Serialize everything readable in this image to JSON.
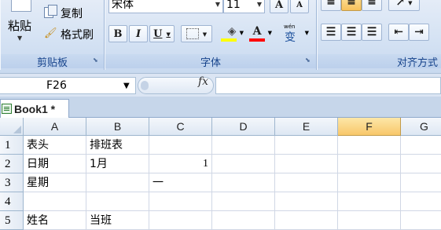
{
  "ribbon": {
    "clipboard": {
      "paste_label": "粘贴",
      "copy_label": "复制",
      "format_painter_label": "格式刷",
      "group_label": "剪贴板"
    },
    "font": {
      "font_name": "宋体",
      "font_size": "11",
      "bold": "B",
      "italic": "I",
      "underline": "U",
      "grow": "A",
      "shrink": "A",
      "font_color": "A",
      "phonetic": "wén",
      "phonetic_char": "变",
      "group_label": "字体",
      "highlight_color": "#ffff00",
      "font_color_value": "#ff0000"
    },
    "alignment": {
      "group_label": "对齐方式"
    }
  },
  "formula_bar": {
    "name_box": "F26",
    "fx": "fx",
    "content": ""
  },
  "workbook": {
    "tab_title": "Book1 *"
  },
  "grid": {
    "columns": [
      "A",
      "B",
      "C",
      "D",
      "E",
      "F",
      "G"
    ],
    "selected_column": "F",
    "rows": [
      {
        "num": "1",
        "cells": [
          "表头",
          "排班表",
          "",
          "",
          "",
          "",
          ""
        ]
      },
      {
        "num": "2",
        "cells": [
          "日期",
          "1月",
          "1",
          "",
          "",
          "",
          ""
        ]
      },
      {
        "num": "3",
        "cells": [
          "星期",
          "",
          "一",
          "",
          "",
          "",
          ""
        ]
      },
      {
        "num": "4",
        "cells": [
          "",
          "",
          "",
          "",
          "",
          "",
          ""
        ]
      },
      {
        "num": "5",
        "cells": [
          "姓名",
          "当班",
          "",
          "",
          "",
          "",
          ""
        ]
      }
    ]
  },
  "colors": {
    "ribbon_label": "#15428b",
    "selected_header": "#f8c76a"
  }
}
